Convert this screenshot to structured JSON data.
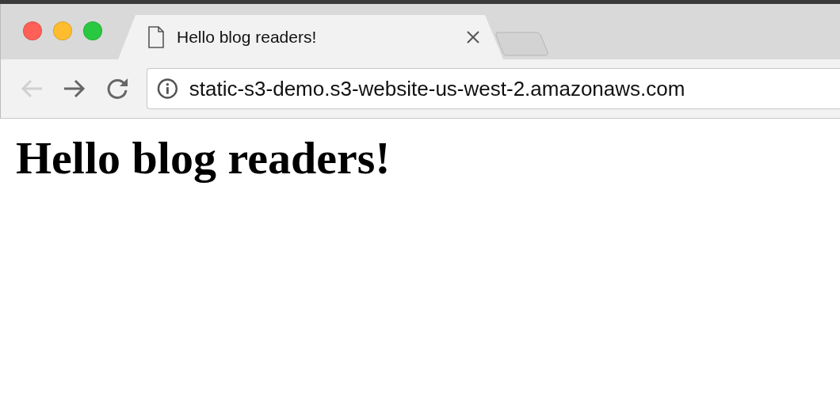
{
  "window": {
    "controls": [
      {
        "color": "#fe5f57"
      },
      {
        "color": "#febc2e"
      },
      {
        "color": "#28c840"
      }
    ]
  },
  "tabs": [
    {
      "title": "Hello blog readers!",
      "selected": true
    }
  ],
  "toolbar": {
    "back": {
      "disabled": true
    },
    "forward": {
      "disabled": false
    },
    "address": "static-s3-demo.s3-website-us-west-2.amazonaws.com"
  },
  "page": {
    "heading": "Hello blog readers!"
  }
}
